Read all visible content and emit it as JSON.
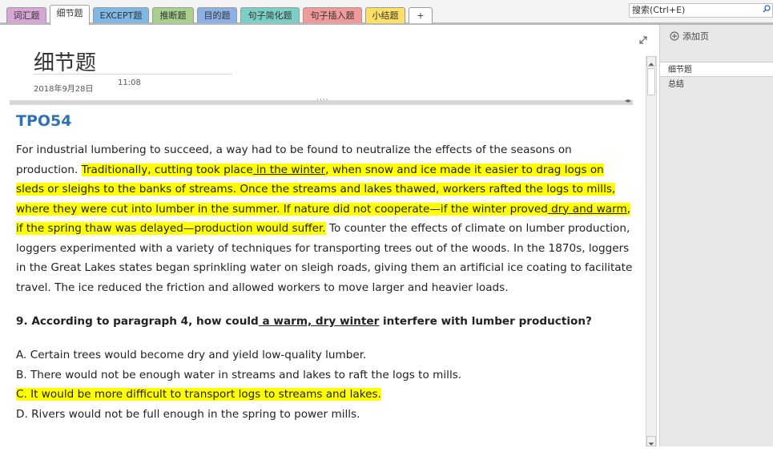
{
  "tabs": [
    {
      "label": "词汇题",
      "color": "#d6a7d6"
    },
    {
      "label": "细节题",
      "color": "#ffffff",
      "active": true
    },
    {
      "label": "EXCEPT题",
      "color": "#7fb8e6"
    },
    {
      "label": "推断题",
      "color": "#a9d18e"
    },
    {
      "label": "目的题",
      "color": "#8db0e6"
    },
    {
      "label": "句子简化题",
      "color": "#7ccfc4"
    },
    {
      "label": "句子插入题",
      "color": "#f19a9a"
    },
    {
      "label": "小结题",
      "color": "#ffe066"
    },
    {
      "label": "+",
      "color": "#ffffff"
    }
  ],
  "search": {
    "placeholder": "搜索(Ctrl+E)"
  },
  "page": {
    "title": "细节题",
    "date": "2018年9月28日",
    "time": "11:08",
    "heading": "TPO54"
  },
  "passage": {
    "s1": "For industrial lumbering to succeed, a way had to be found to neutralize the effects of the seasons on production. ",
    "h1": "Traditionally, cutting took place",
    "h2": " in the winter",
    "h3": ", when snow and ice made it easier to drag logs on sleds or sleighs to the banks of streams. Once the streams and lakes thawed, workers rafted the logs to mills, where they were cut into lumber in the summer. If nature did not cooperate—if the winter proved",
    "h4": " dry and warm",
    "h5": ", if the spring thaw was delayed—production would suffer.",
    "s2": " To counter the effects of climate on lumber production, loggers experimented with a variety of techniques for transporting trees out of the woods. In the 1870s, loggers in the Great Lakes states began sprinkling water on sleigh roads, giving them an artificial ice coating to facilitate travel. The ice reduced the friction and allowed workers to move larger and heavier loads."
  },
  "question": {
    "q1": "9. According to paragraph 4, how could",
    "q2": " a warm, dry winter",
    "q3": " interfere with lumber production?"
  },
  "options": [
    {
      "text": "A. Certain trees would become dry and yield low-quality lumber.",
      "highlight": false
    },
    {
      "text": "B. There would not be enough water in streams and lakes to raft the logs to mills.",
      "highlight": false
    },
    {
      "text": "C. It would be more difficult to transport logs to streams and lakes.",
      "highlight": true
    },
    {
      "text": "D. Rivers would not be full enough in the spring to power mills.",
      "highlight": false
    }
  ],
  "sidebar": {
    "add_page": "添加页",
    "pages": [
      "细节题",
      "总结"
    ]
  },
  "colors": {
    "highlight": "#ffff00",
    "heading": "#2e74b5"
  }
}
